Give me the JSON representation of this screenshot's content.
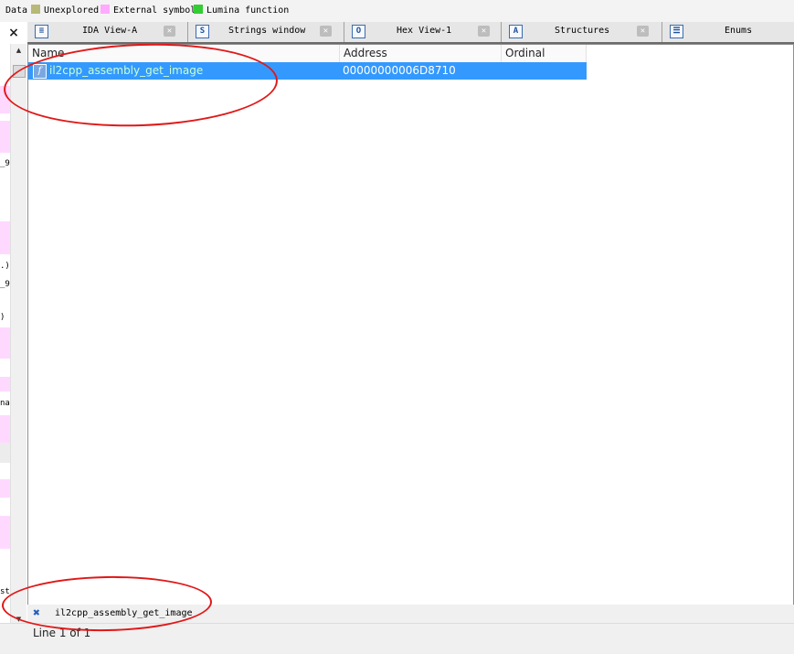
{
  "legend": {
    "items": [
      {
        "label": "Data",
        "color": ""
      },
      {
        "label": "Unexplored",
        "color": "#b8b878"
      },
      {
        "label": "External symbol",
        "color": "#ffaaff"
      },
      {
        "label": "Lumina function",
        "color": "#33cc33"
      }
    ]
  },
  "side_panel": {
    "close_glyph": "×",
    "fragments": [
      "_9",
      ".)",
      "_9",
      ")",
      "na",
      "st"
    ]
  },
  "tabs": [
    {
      "label": "IDA View-A",
      "icon": "ida-view-icon",
      "glyph": "≡"
    },
    {
      "label": "Strings window",
      "icon": "strings-icon",
      "glyph": "S"
    },
    {
      "label": "Hex View-1",
      "icon": "hex-view-icon",
      "glyph": "O"
    },
    {
      "label": "Structures",
      "icon": "structures-icon",
      "glyph": "A"
    },
    {
      "label": "Enums",
      "icon": "enums-icon",
      "glyph": "☰"
    }
  ],
  "table": {
    "columns": [
      "Name",
      "Address",
      "Ordinal"
    ],
    "rows": [
      {
        "name": "il2cpp_assembly_get_image",
        "address": "00000000006D8710",
        "ordinal": "",
        "selected": true
      }
    ]
  },
  "filter": {
    "text": "il2cpp_assembly_get_image",
    "clear_glyph": "✖"
  },
  "status": {
    "text": "Line 1 of 1"
  },
  "colors": {
    "selection": "#3399ff",
    "annotation_ring": "#e01818"
  }
}
